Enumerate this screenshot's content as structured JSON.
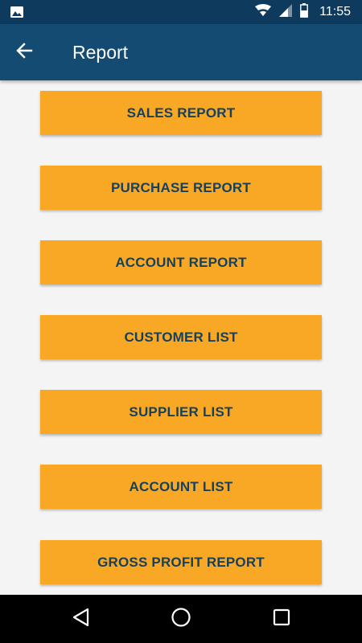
{
  "status_bar": {
    "time": "11:55",
    "icons": [
      "image-notification-icon",
      "wifi-icon",
      "signal-icon",
      "battery-icon"
    ]
  },
  "app_bar": {
    "title": "Report",
    "back_icon": "arrow-back-icon"
  },
  "report_buttons": [
    {
      "label": "SALES REPORT"
    },
    {
      "label": "PURCHASE REPORT"
    },
    {
      "label": "ACCOUNT REPORT"
    },
    {
      "label": "CUSTOMER LIST"
    },
    {
      "label": "SUPPLIER LIST"
    },
    {
      "label": "ACCOUNT LIST"
    },
    {
      "label": "GROSS PROFIT REPORT"
    }
  ],
  "nav_bar": {
    "icons": [
      "back-triangle-icon",
      "home-circle-icon",
      "recents-square-icon"
    ]
  },
  "colors": {
    "status_bar": "#0e3a5e",
    "app_bar": "#144b72",
    "button_bg": "#f9a825",
    "button_text": "#15415f",
    "background": "#f4f4f4"
  }
}
